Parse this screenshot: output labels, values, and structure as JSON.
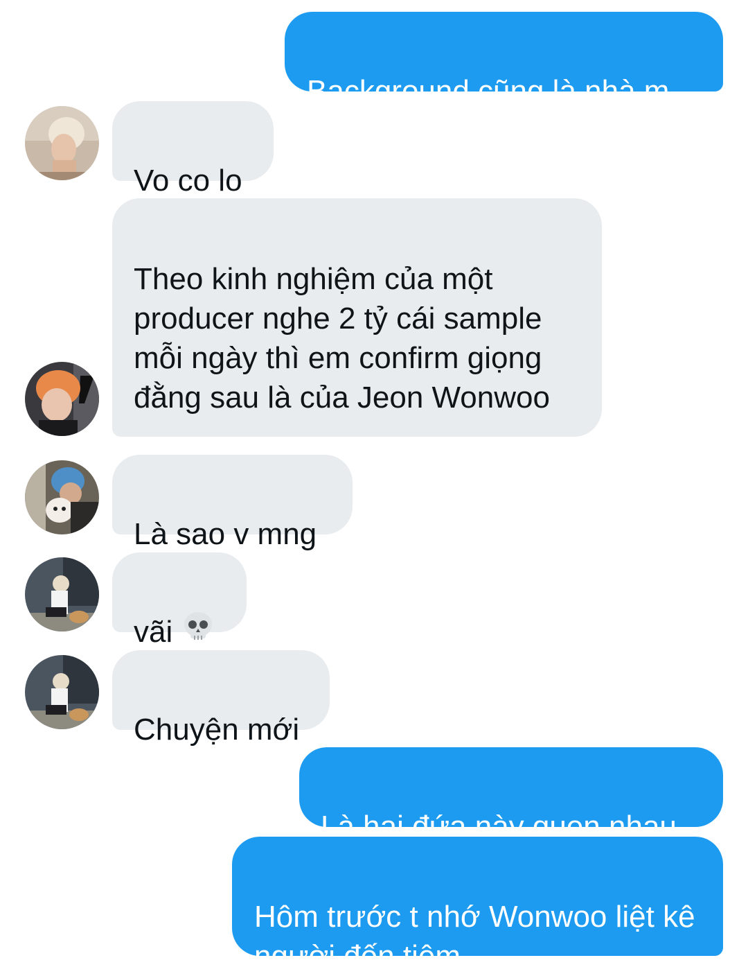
{
  "messages": [
    {
      "direction": "outgoing",
      "text": "Background cũng là nhà m"
    },
    {
      "direction": "incoming",
      "text": "Vo co lo",
      "avatar": "avatar-blonde-profile"
    },
    {
      "direction": "incoming",
      "text": "Theo kinh nghiệm của một producer nghe 2 tỷ cái sample mỗi ngày thì em confirm giọng đằng sau là của Jeon Wonwoo",
      "avatar": "avatar-orange-hair"
    },
    {
      "direction": "incoming",
      "text": "Là sao v mng",
      "avatar": "avatar-blue-hair-dog"
    },
    {
      "direction": "incoming",
      "text": "vãi",
      "emoji": "skull-emoji",
      "avatar": "avatar-crouching-dog"
    },
    {
      "direction": "incoming",
      "text": "Chuyện mới",
      "avatar": "avatar-crouching-dog"
    },
    {
      "direction": "outgoing",
      "text": "Là hai đứa này quen nhau"
    },
    {
      "direction": "outgoing",
      "text": "Hôm trước t nhớ Wonwoo liệt kê người đến tiệm"
    }
  ],
  "colors": {
    "outgoing_bubble": "#1d9bf0",
    "outgoing_text": "#ffffff",
    "incoming_bubble": "#e8ecef",
    "incoming_text": "#0f1419",
    "background": "#ffffff"
  }
}
